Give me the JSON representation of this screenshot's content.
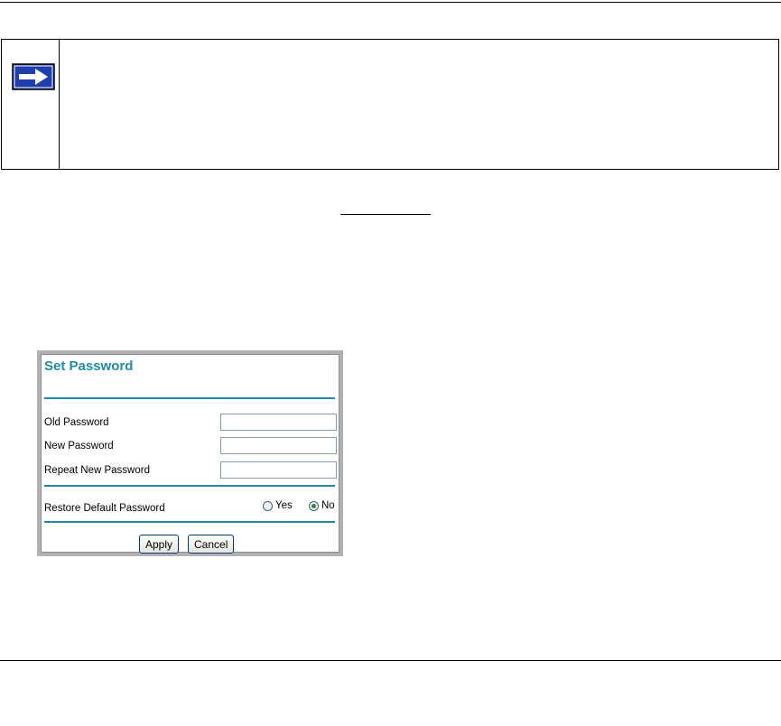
{
  "note": {
    "icon": "arrow-right-icon"
  },
  "set_password": {
    "title": "Set Password",
    "old_password_label": "Old Password",
    "new_password_label": "New Password",
    "repeat_password_label": "Repeat New Password",
    "old_password_value": "",
    "new_password_value": "",
    "repeat_password_value": "",
    "restore_default_label": "Restore Default Password",
    "restore_options": [
      "Yes",
      "No"
    ],
    "restore_selected": "No",
    "apply_label": "Apply",
    "cancel_label": "Cancel"
  },
  "colors": {
    "accent": "#1f8ba7",
    "icon_blue": "#1f3fae"
  }
}
